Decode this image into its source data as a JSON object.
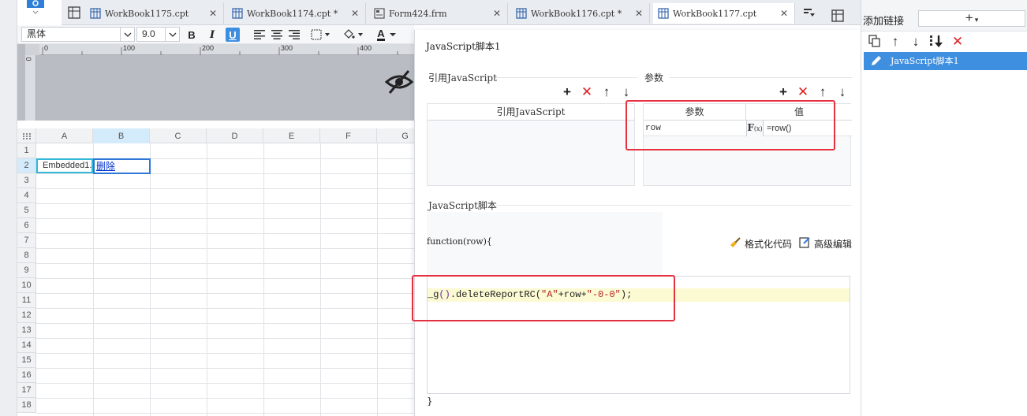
{
  "tabs": [
    {
      "label": "WorkBook1175.cpt",
      "icon": "workbook-icon",
      "active": false
    },
    {
      "label": "WorkBook1174.cpt *",
      "icon": "workbook-icon",
      "active": false
    },
    {
      "label": "Form424.frm",
      "icon": "form-icon",
      "active": false
    },
    {
      "label": "WorkBook1176.cpt *",
      "icon": "workbook-icon",
      "active": false
    },
    {
      "label": "WorkBook1177.cpt",
      "icon": "workbook-icon",
      "active": true
    }
  ],
  "toolbar": {
    "font_family": "黑体",
    "font_size": "9.0",
    "bold": "B",
    "italic": "I",
    "underline": "U",
    "font_color_letter": "A"
  },
  "ruler": {
    "ticks": [
      "0",
      "100",
      "200",
      "300",
      "400"
    ]
  },
  "grid": {
    "columns": [
      "A",
      "B",
      "C",
      "D",
      "E",
      "F",
      "G"
    ],
    "rows": [
      "1",
      "2",
      "3",
      "4",
      "5",
      "6",
      "7",
      "8",
      "9",
      "10",
      "11",
      "12",
      "13",
      "14",
      "15",
      "16",
      "17",
      "18"
    ],
    "cells": {
      "A2": "Embedded1.",
      "B2": "删除"
    }
  },
  "dialog": {
    "title": "JavaScript脚本1",
    "library_section": "引用JavaScript",
    "library_column": "引用JavaScript",
    "params_section": "参数",
    "params_columns": [
      "参数",
      "值"
    ],
    "params": [
      {
        "name": "row",
        "fx": "F",
        "value": "=row()"
      }
    ],
    "script_section": "JavaScript脚本",
    "function_signature": "function(row){",
    "format_label": "格式化代码",
    "advanced_label": "高级编辑",
    "code_tokens": {
      "prefix": "_g",
      "open_paren": "(",
      "close_paren": ")",
      "call": ".deleteReportRC(",
      "str1": "\"A\"",
      "plus1": "+row+",
      "str2": "\"-0-0\"",
      "tail": ");"
    },
    "closing_brace": "}"
  },
  "right_panel": {
    "add_link_label": "添加链接",
    "add_link_button": "+",
    "links": [
      {
        "label": "JavaScript脚本1",
        "selected": true
      }
    ]
  },
  "colors": {
    "accent": "#3f8fe0",
    "highlight_red": "#e53040",
    "delete_red": "#e02020",
    "code_line_bg": "#fbfad2"
  }
}
